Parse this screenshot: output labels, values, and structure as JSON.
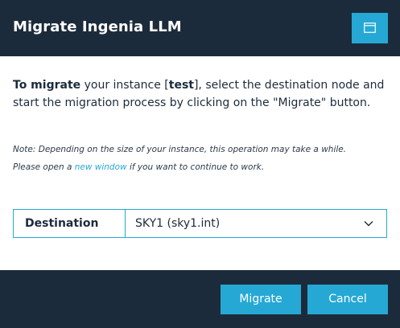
{
  "dialog": {
    "title": "Migrate Ingenia LLM"
  },
  "intro": {
    "bold_lead": "To migrate",
    "part1": " your instance [",
    "instance_name": "test",
    "part2": "], select the destination node and start the migration process by clicking on the \"Migrate\" button."
  },
  "note": {
    "part1": "Note: Depending on the size of your instance, this operation may take a while.",
    "part2": "Please open a ",
    "link_text": "new window",
    "part3": " if you want to continue to work."
  },
  "destination": {
    "label": "Destination",
    "selected": "SKY1 (sky1.int)"
  },
  "footer": {
    "migrate_label": "Migrate",
    "cancel_label": "Cancel"
  },
  "colors": {
    "header_bg": "#1c2b3c",
    "accent": "#26a8d5",
    "text": "#1c2b3c"
  },
  "icons": {
    "window": "window-icon",
    "dropdown": "chevron-down-icon"
  }
}
